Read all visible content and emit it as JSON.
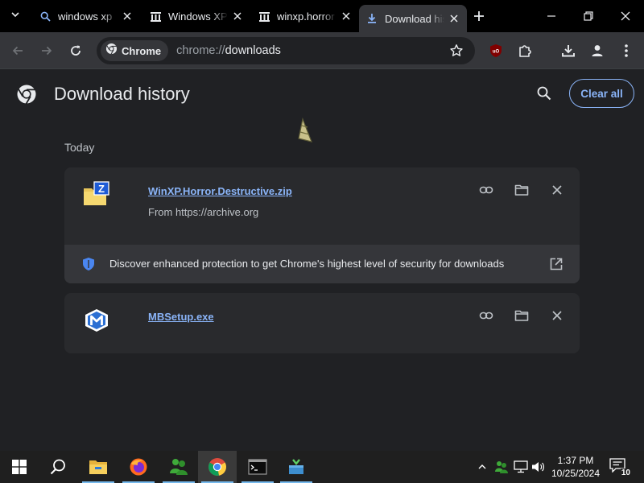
{
  "tabs": [
    {
      "title": "windows xp",
      "icon": "search-icon"
    },
    {
      "title": "Windows XP",
      "icon": "archive-icon"
    },
    {
      "title": "winxp.horror",
      "icon": "archive-icon"
    },
    {
      "title": "Download history",
      "icon": "download-icon",
      "active": true
    }
  ],
  "omnibox": {
    "chip_label": "Chrome",
    "url_scheme": "chrome://",
    "url_path": "downloads"
  },
  "page": {
    "title": "Download history",
    "clear_all_label": "Clear all",
    "date_group": "Today"
  },
  "downloads": [
    {
      "file_name": "WinXP.Horror.Destructive.zip",
      "source": "From https://archive.org"
    },
    {
      "file_name": "MBSetup.exe"
    }
  ],
  "banner": {
    "text": "Discover enhanced protection to get Chrome's highest level of security for downloads"
  },
  "taskbar": {
    "time": "1:37 PM",
    "date": "10/25/2024",
    "notification_count": "10"
  },
  "colors": {
    "accent": "#8ab4f8",
    "page_bg": "#202124",
    "card_bg": "#292a2d",
    "toolbar_bg": "#35363a"
  }
}
